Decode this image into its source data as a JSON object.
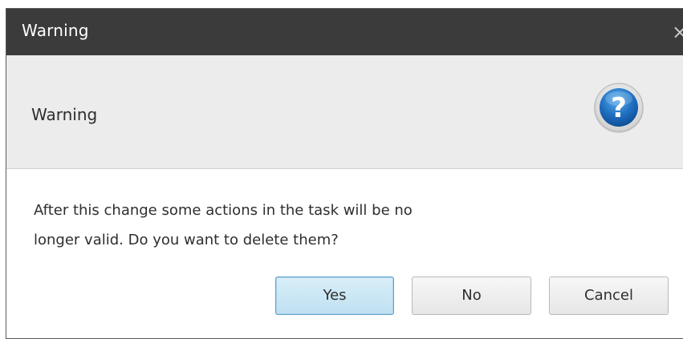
{
  "window": {
    "title": "Warning",
    "close_glyph": "×"
  },
  "header": {
    "title": "Warning",
    "icon": "question-icon"
  },
  "body": {
    "message_line1": "After this change some actions in the task will be no",
    "message_line2": "longer valid. Do you want to delete them?"
  },
  "buttons": {
    "yes": "Yes",
    "no": "No",
    "cancel": "Cancel"
  },
  "colors": {
    "titlebar": "#3b3b3b",
    "header_bg": "#ececec",
    "default_button_border": "#5fa3c9",
    "icon_blue": "#1f6fc0"
  }
}
